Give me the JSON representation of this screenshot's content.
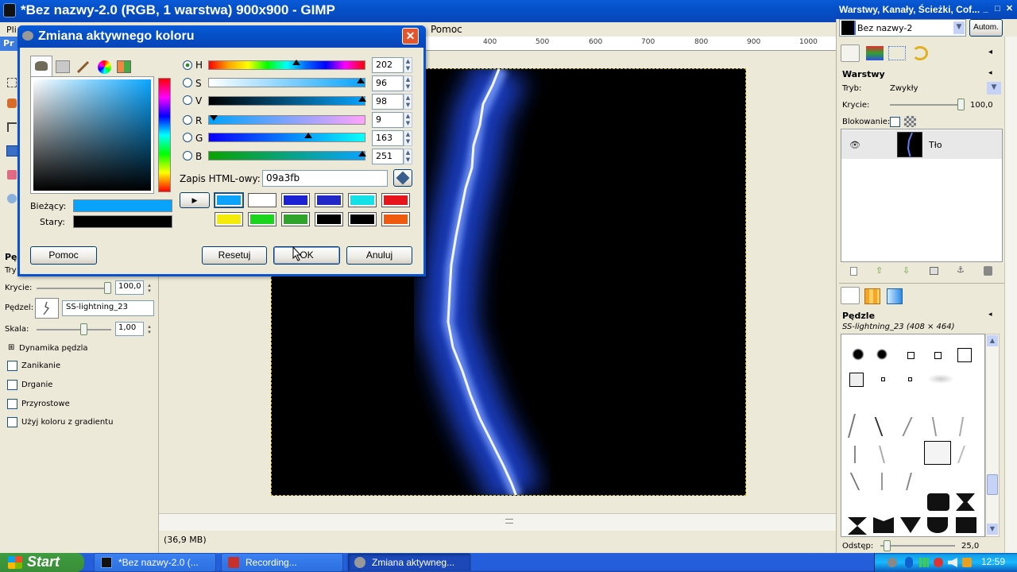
{
  "gimp_window": {
    "title": "*Bez nazwy-2.0 (RGB, 1 warstwa) 900x900 - GIMP",
    "menu_file_partial": "Pli",
    "status_size": "(36,9 MB)"
  },
  "toolbox": {
    "header_partial": "Pr",
    "brush_header_partial": "Pę",
    "mode_label_partial": "Try",
    "opacity_label": "Krycie:",
    "opacity_value": "100,0",
    "brush_label": "Pędzel:",
    "brush_name": "SS-lightning_23",
    "scale_label": "Skala:",
    "scale_value": "1,00",
    "dynamics_label": "Dynamika pędzla",
    "options": [
      "Zanikanie",
      "Drganie",
      "Przyrostowe",
      "Użyj koloru z gradientu"
    ]
  },
  "ruler": {
    "help_partial": "Pomoc",
    "ticks": [
      "400",
      "500",
      "600",
      "700",
      "800",
      "900",
      "1000"
    ]
  },
  "dialog": {
    "title": "Zmiana aktywnego koloru",
    "channels": [
      {
        "label": "H",
        "value": "202",
        "level": 0.56
      },
      {
        "label": "S",
        "value": "96",
        "level": 0.96
      },
      {
        "label": "V",
        "value": "98",
        "level": 0.98
      },
      {
        "label": "R",
        "value": "9",
        "level": 0.035
      },
      {
        "label": "G",
        "value": "163",
        "level": 0.64
      },
      {
        "label": "B",
        "value": "251",
        "level": 0.98
      }
    ],
    "html_label": "Zapis HTML-owy:",
    "html_value": "09a3fb",
    "current_label": "Bieżący:",
    "old_label": "Stary:",
    "current_color": "#09A3FB",
    "old_color": "#000000",
    "history_colors": [
      "#0BA3FB",
      "#FFFFFF",
      "#1C22D4",
      "#2228C8",
      "#14E0E8",
      "#E8141C",
      "#F5EB0A",
      "#1BD41E",
      "#2FA32A",
      "#000000",
      "#000000",
      "#F05A0F"
    ],
    "buttons": {
      "help": "Pomoc",
      "reset": "Resetuj",
      "ok": "OK",
      "cancel": "Anuluj"
    }
  },
  "dock": {
    "title": "Warstwy, Kanały, Ścieżki, Cof...",
    "image_name": "Bez nazwy-2",
    "auto_button": "Autom.",
    "layers": {
      "header": "Warstwy",
      "mode_label": "Tryb:",
      "mode_value": "Zwykły",
      "opacity_label": "Krycie:",
      "opacity_value": "100,0",
      "lock_label": "Blokowanie:",
      "layer_name": "Tło"
    },
    "brushes": {
      "header": "Pędzle",
      "selected": "SS-lightning_23 (408 × 464)",
      "spacing_label": "Odstęp:",
      "spacing_value": "25,0"
    }
  },
  "taskbar": {
    "start": "Start",
    "items": [
      "*Bez nazwy-2.0 (...",
      "Recording...",
      "Zmiana aktywneg..."
    ],
    "clock": "12:59"
  }
}
